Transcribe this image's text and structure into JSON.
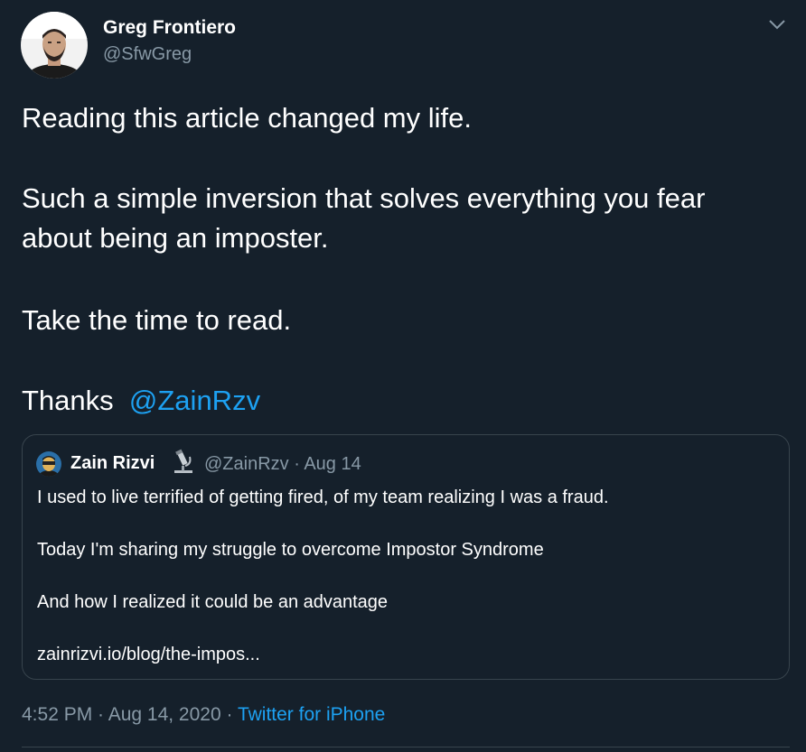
{
  "author": {
    "name": "Greg Frontiero",
    "handle": "@SfwGreg"
  },
  "tweet": {
    "line1": "Reading this article changed my life.",
    "line2": "Such a simple inversion that solves everything you fear",
    "line3": "about being an imposter.",
    "line4": "Take the time to read.",
    "line5_prefix": "Thanks ",
    "mention": "@ZainRzv"
  },
  "quoted_tweet": {
    "name": "Zain Rizvi",
    "emoji_icon": "microscope-icon",
    "meta": "@ZainRzv · Aug 14",
    "line1": "I used to live terrified of getting fired, of my team realizing I was a fraud.",
    "line2": "Today I'm sharing my struggle to overcome Impostor Syndrome",
    "line3": "And how I realized it could be an advantage",
    "link": "zainrizvi.io/blog/the-impos..."
  },
  "footer": {
    "time": "4:52 PM · Aug 14, 2020 · ",
    "source": "Twitter for iPhone"
  },
  "colors": {
    "background": "#15202b",
    "accent": "#1da1f2",
    "secondary_text": "#8899a6",
    "border": "#38444d"
  }
}
